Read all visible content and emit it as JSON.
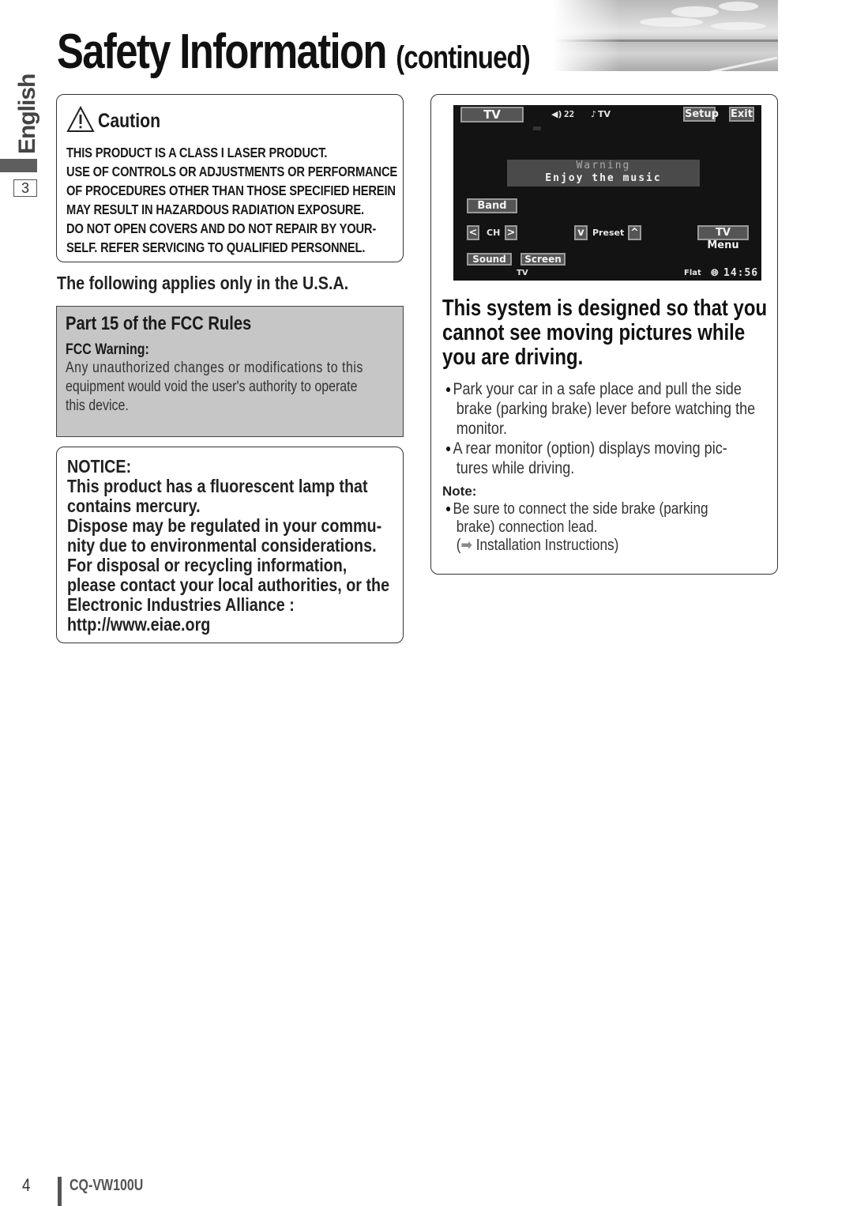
{
  "header": {
    "title": "Safety Information",
    "subtitle": "(continued)",
    "photo": "landscape-road-sky-image"
  },
  "sidebar": {
    "language": "English",
    "section_number": "3"
  },
  "caution": {
    "icon": "warning-triangle-icon",
    "title": "Caution",
    "lines": [
      "THIS PRODUCT IS A CLASS I LASER PRODUCT.",
      "USE OF CONTROLS OR ADJUSTMENTS OR PERFORMANCE",
      "OF PROCEDURES OTHER THAN THOSE SPECIFIED HEREIN",
      "MAY RESULT IN HAZARDOUS RADIATION EXPOSURE.",
      "DO NOT OPEN COVERS AND DO NOT REPAIR BY YOUR-",
      "SELF. REFER SERVICING TO QUALIFIED PERSONNEL."
    ]
  },
  "usa_note": "The following applies only in the U.S.A.",
  "fcc": {
    "title": "Part 15 of the FCC Rules",
    "warning_label": "FCC Warning:",
    "lines": [
      "Any unauthorized changes or modifications to this",
      "equipment would void the user's authority to operate",
      "this device."
    ]
  },
  "notice": {
    "lines": [
      "NOTICE:",
      "This product has a fluorescent lamp that",
      "contains mercury.",
      "Dispose may be regulated in your commu-",
      "nity due to environmental considerations.",
      "For disposal or recycling information,",
      "please contact your local authorities, or the",
      "Electronic Industries Alliance :",
      "http://www.eiae.org"
    ]
  },
  "tv_screen": {
    "source_button": "TV",
    "volume": "22",
    "volume_icon": "speaker-icon",
    "music_icon": "music-note-icon",
    "source_indicator": "TV",
    "setup_button": "Setup",
    "exit_button": "Exit",
    "warning_title": "Warning",
    "warning_message": "Enjoy the music",
    "band_button": "Band",
    "ch_label": "CH",
    "ch_prev": "<",
    "ch_next": ">",
    "preset_label": "Preset",
    "preset_down": "v",
    "preset_up": "^",
    "tv_menu_button": "TV Menu",
    "sound_button": "Sound",
    "screen_button": "Screen",
    "bottom_source": "TV",
    "eq_mode": "Flat",
    "clock_icon": "globe-clock-icon",
    "time": "14:56"
  },
  "driving": {
    "title_lines": [
      "This system is designed so that you",
      "cannot see moving pictures while",
      "you are driving."
    ],
    "bullets": [
      [
        "Park your car in a safe place and pull the side",
        "brake (parking brake) lever before watching the",
        "monitor."
      ],
      [
        "A rear monitor (option) displays moving pic-",
        "tures while driving."
      ]
    ],
    "note_label": "Note:",
    "note_lines": [
      "Be sure to connect the side brake (parking",
      "brake) connection lead.",
      "Installation Instructions)"
    ],
    "note_ref_prefix": "(",
    "bullet_glyph": "●",
    "arrow_glyph": "➡"
  },
  "footer": {
    "page_number": "4",
    "model": "CQ-VW100U"
  }
}
